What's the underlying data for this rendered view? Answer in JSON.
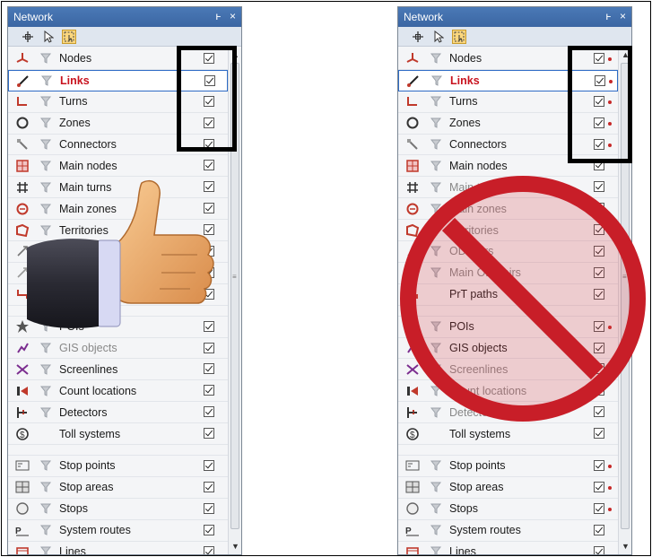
{
  "panel": {
    "title": "Network",
    "pin": "ͱ",
    "close": "×"
  },
  "toolbar": [
    "crosshair-tool",
    "pointer-tool",
    "select-rect-tool"
  ],
  "left_rows": [
    {
      "label": "Nodes",
      "icon": "node-icon",
      "filter": true
    },
    {
      "label": "Links",
      "icon": "link-icon",
      "filter": true,
      "selected": true
    },
    {
      "label": "Turns",
      "icon": "turn-icon",
      "filter": true
    },
    {
      "label": "Zones",
      "icon": "zone-icon",
      "filter": true
    },
    {
      "label": "Connectors",
      "icon": "connector-icon",
      "filter": true
    },
    {
      "label": "Main nodes",
      "icon": "main-node-icon",
      "filter": true
    },
    {
      "label": "Main turns",
      "icon": "main-turn-icon",
      "filter": true
    },
    {
      "label": "Main zones",
      "icon": "main-zone-icon",
      "filter": true
    },
    {
      "label": "Territories",
      "icon": "territory-icon",
      "filter": true
    },
    {
      "label": "",
      "icon": "od-pair-icon",
      "filter": true,
      "hidden": true
    },
    {
      "label": "",
      "icon": "main-od-pair-icon",
      "filter": true,
      "hidden": true
    },
    {
      "label": "",
      "icon": "prt-path-icon",
      "filter": false,
      "hidden": true
    },
    {
      "gap": true
    },
    {
      "label": "POIs",
      "icon": "poi-icon",
      "filter": true,
      "hidden": true
    },
    {
      "label": "GIS objects",
      "icon": "gis-icon",
      "filter": true,
      "grey": true
    },
    {
      "label": "Screenlines",
      "icon": "screenline-icon",
      "filter": true
    },
    {
      "label": "Count locations",
      "icon": "count-location-icon",
      "filter": true
    },
    {
      "label": "Detectors",
      "icon": "detector-icon",
      "filter": true
    },
    {
      "label": "Toll systems",
      "icon": "toll-icon",
      "filter": false
    },
    {
      "gap": true
    },
    {
      "label": "Stop points",
      "icon": "stop-point-icon",
      "filter": true
    },
    {
      "label": "Stop areas",
      "icon": "stop-area-icon",
      "filter": true
    },
    {
      "label": "Stops",
      "icon": "stop-icon",
      "filter": true
    },
    {
      "label": "System routes",
      "icon": "system-route-icon",
      "filter": true
    },
    {
      "label": "Lines",
      "icon": "line-icon",
      "filter": true
    }
  ],
  "right_rows": [
    {
      "label": "Nodes",
      "icon": "node-icon",
      "filter": true,
      "dot": true
    },
    {
      "label": "Links",
      "icon": "link-icon",
      "filter": true,
      "selected": true,
      "dot": true
    },
    {
      "label": "Turns",
      "icon": "turn-icon",
      "filter": true,
      "dot": true
    },
    {
      "label": "Zones",
      "icon": "zone-icon",
      "filter": true,
      "dot": true
    },
    {
      "label": "Connectors",
      "icon": "connector-icon",
      "filter": true,
      "dot": true
    },
    {
      "label": "Main nodes",
      "icon": "main-node-icon",
      "filter": true
    },
    {
      "label": "Main turns",
      "icon": "main-turn-icon",
      "filter": true,
      "grey": true
    },
    {
      "label": "Main zones",
      "icon": "main-zone-icon",
      "filter": true,
      "grey": true
    },
    {
      "label": "Territories",
      "icon": "territory-icon",
      "filter": true,
      "grey": true
    },
    {
      "label": "OD pairs",
      "icon": "od-pair-icon",
      "filter": true,
      "grey": true
    },
    {
      "label": "Main OD pairs",
      "icon": "main-od-pair-icon",
      "filter": true,
      "grey": true
    },
    {
      "label": "PrT paths",
      "icon": "prt-path-icon",
      "filter": false
    },
    {
      "gap": true
    },
    {
      "label": "POIs",
      "icon": "poi-icon",
      "filter": true,
      "dot": true
    },
    {
      "label": "GIS objects",
      "icon": "gis-icon",
      "filter": true
    },
    {
      "label": "Screenlines",
      "icon": "screenline-icon",
      "filter": true,
      "grey": true
    },
    {
      "label": "Count locations",
      "icon": "count-location-icon",
      "filter": true,
      "grey": true
    },
    {
      "label": "Detectors",
      "icon": "detector-icon",
      "filter": true,
      "grey": true
    },
    {
      "label": "Toll systems",
      "icon": "toll-icon",
      "filter": false
    },
    {
      "gap": true
    },
    {
      "label": "Stop points",
      "icon": "stop-point-icon",
      "filter": true,
      "dot": true
    },
    {
      "label": "Stop areas",
      "icon": "stop-area-icon",
      "filter": true,
      "dot": true
    },
    {
      "label": "Stops",
      "icon": "stop-icon",
      "filter": true,
      "dot": true
    },
    {
      "label": "System routes",
      "icon": "system-route-icon",
      "filter": true
    },
    {
      "label": "Lines",
      "icon": "line-icon",
      "filter": true
    }
  ],
  "colors": {
    "titlebar": "#3d6aa8",
    "selected_text": "#c8121e",
    "prohibit_red": "#c81e28",
    "highlight_box": "#000000"
  }
}
